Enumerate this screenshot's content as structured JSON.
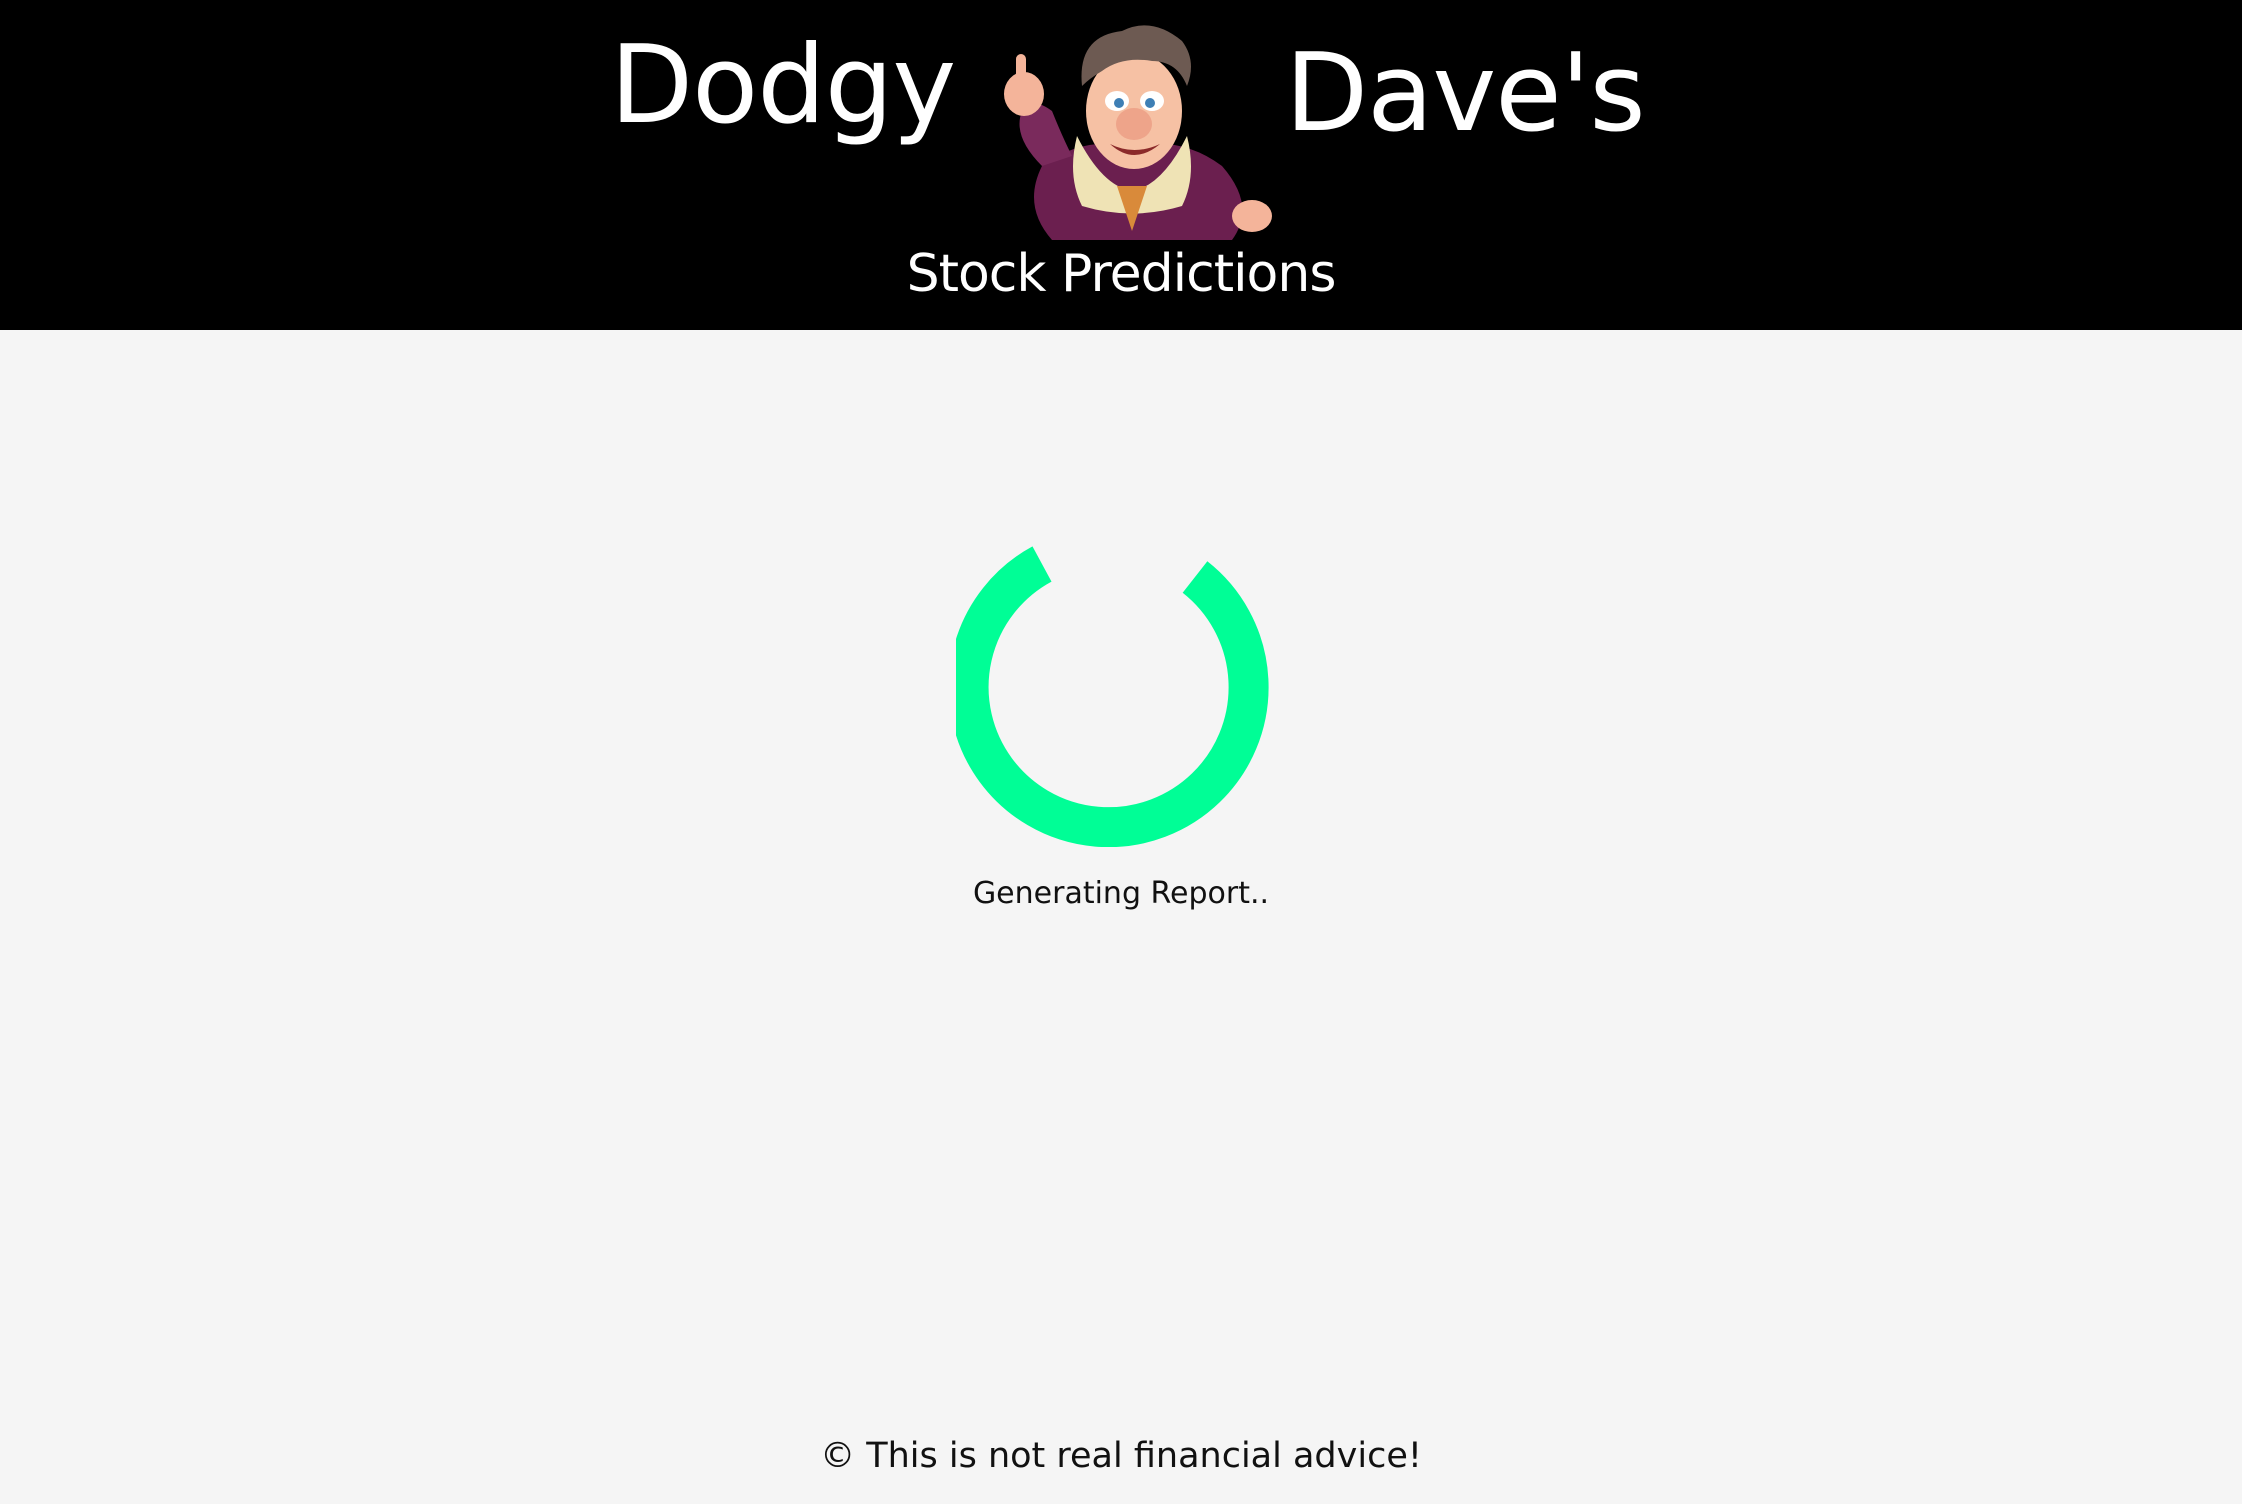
{
  "header": {
    "logo": {
      "word_left": "Dodgy",
      "word_right": "Dave's",
      "subtitle": "Stock Predictions",
      "mascot": "cartoon-salesman-mascot"
    },
    "background_color": "#000000"
  },
  "main": {
    "spinner": {
      "icon": "loading-spinner-icon",
      "color": "#00fe96"
    },
    "status_text": "Generating Report.."
  },
  "footer": {
    "text": "© This is not real financial advice!"
  },
  "colors": {
    "page_background": "#f5f5f5",
    "text": "#111111",
    "accent": "#00fe96"
  }
}
